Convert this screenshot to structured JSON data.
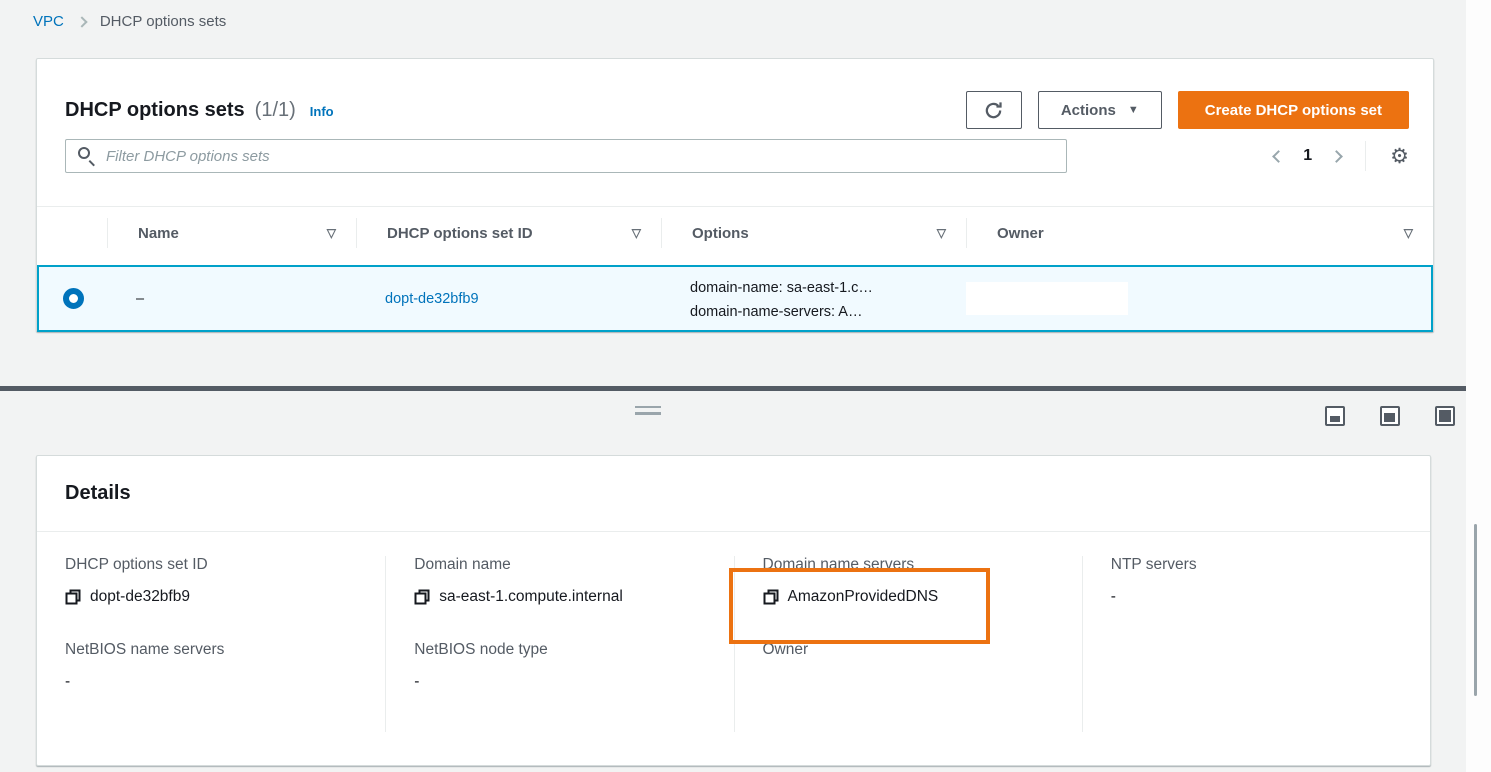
{
  "colors": {
    "primary_button": "#ec7211",
    "link": "#0073bb",
    "selected_row_border": "#00a1c9",
    "selected_row_bg": "#f1faff",
    "annotation_highlight": "#ec7211",
    "split_divider": "#545b64"
  },
  "icons": {
    "caret_down": "▼",
    "sort_indicator": "▽",
    "gear": "⚙"
  },
  "breadcrumb": {
    "items": [
      {
        "label": "VPC"
      },
      {
        "label": "DHCP options sets"
      }
    ]
  },
  "table_panel": {
    "title": "DHCP options sets",
    "counter": "(1/1)",
    "info_label": "Info",
    "refresh_button": "refresh",
    "actions_label": "Actions",
    "create_label": "Create DHCP options set",
    "filter_placeholder": "Filter DHCP options sets",
    "filter_value": "",
    "pagination": {
      "page": "1"
    },
    "columns": [
      "Name",
      "DHCP options set ID",
      "Options",
      "Owner"
    ],
    "row": {
      "selected": true,
      "name": "–",
      "id": "dopt-de32bfb9",
      "options_line1": "domain-name: sa-east-1.c…",
      "options_line2": "domain-name-servers: A…",
      "owner": ""
    }
  },
  "details_panel": {
    "title": "Details",
    "columns": [
      {
        "fields": [
          {
            "label": "DHCP options set ID",
            "value": "dopt-de32bfb9"
          },
          {
            "label": "NetBIOS name servers",
            "value": "-"
          }
        ]
      },
      {
        "fields": [
          {
            "label": "Domain name",
            "value": "sa-east-1.compute.internal"
          },
          {
            "label": "NetBIOS node type",
            "value": "-"
          }
        ]
      },
      {
        "fields": [
          {
            "label": "Domain name servers",
            "value": "AmazonProvidedDNS",
            "highlighted": true
          },
          {
            "label": "Owner",
            "value": ""
          }
        ]
      },
      {
        "fields": [
          {
            "label": "NTP servers",
            "value": "-"
          }
        ]
      }
    ]
  }
}
